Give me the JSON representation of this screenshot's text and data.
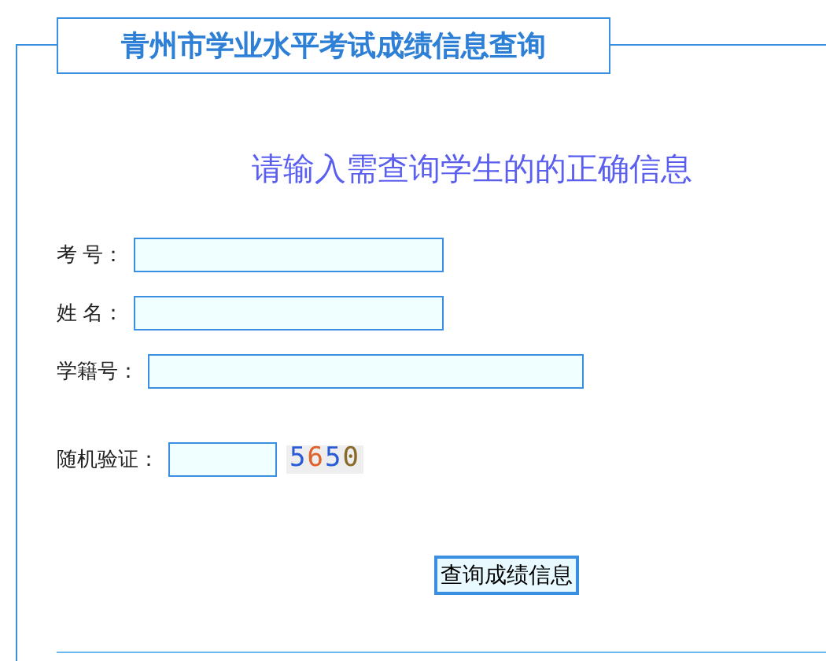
{
  "title": "青州市学业水平考试成绩信息查询",
  "subtitle": "请输入需查询学生的的正确信息",
  "fields": [
    {
      "label": "考 号：",
      "kind": "short"
    },
    {
      "label": "姓 名：",
      "kind": "short"
    },
    {
      "label": "学籍号：",
      "kind": "long"
    }
  ],
  "captcha": {
    "label": "随机验证：",
    "digits": [
      {
        "text": "5",
        "color": "#2a5bd7"
      },
      {
        "text": "6",
        "color": "#e0612a"
      },
      {
        "text": "5",
        "color": "#2a5bd7"
      },
      {
        "text": "0",
        "color": "#8a6a2a"
      }
    ]
  },
  "submit": "查询成绩信息"
}
